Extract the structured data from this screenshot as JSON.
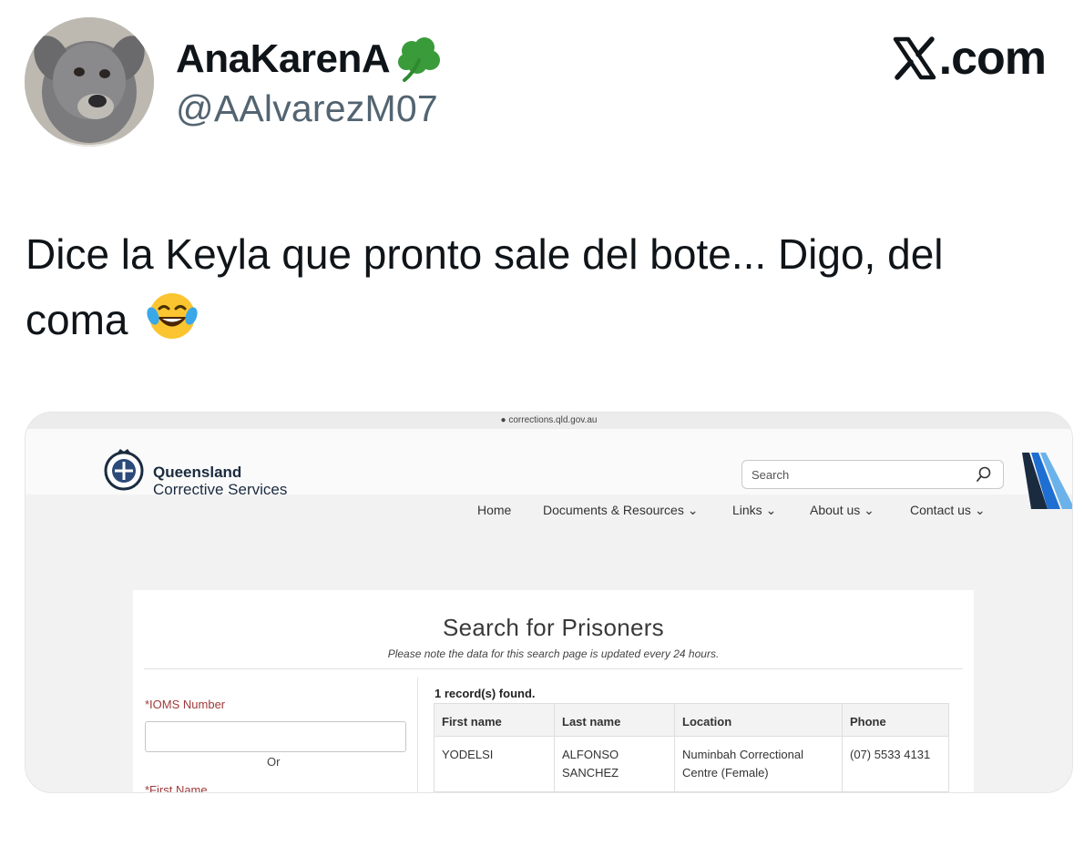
{
  "tweet": {
    "display_name": "AnaKarenA",
    "name_emoji": "shamrock-icon",
    "handle": "@AAlvarezM07",
    "brand": ".com",
    "brand_icon": "x-logo-icon",
    "text": "Dice la Keyla que pronto sale del bote... Digo, del coma",
    "text_emoji": "face-with-tears-of-joy-icon"
  },
  "screenshot": {
    "url": "corrections.qld.gov.au",
    "logo_line1": "Queensland",
    "logo_line2": "Corrective Services",
    "search_placeholder": "Search",
    "nav": [
      "Home",
      "Documents & Resources",
      "Links",
      "About us",
      "Contact us"
    ],
    "title": "Search for Prisoners",
    "note": "Please note the data for this search page is updated every 24 hours.",
    "iom_label": "*IOMS Number",
    "or_label": "Or",
    "first_name_label": "*First Name",
    "records_found": "1 record(s) found.",
    "columns": [
      "First name",
      "Last name",
      "Location",
      "Phone"
    ],
    "rows": [
      {
        "first_name": "YODELSI",
        "last_name": "ALFONSO SANCHEZ",
        "location": "Numinbah Correctional Centre (Female)",
        "phone": "(07) 5533 4131"
      }
    ]
  },
  "colors": {
    "text": "#0f1419",
    "secondary": "#536471",
    "qcs_navy": "#1a2b40",
    "form_label_red": "#a03a3a",
    "stripe_blue": "#1e6fd1"
  }
}
